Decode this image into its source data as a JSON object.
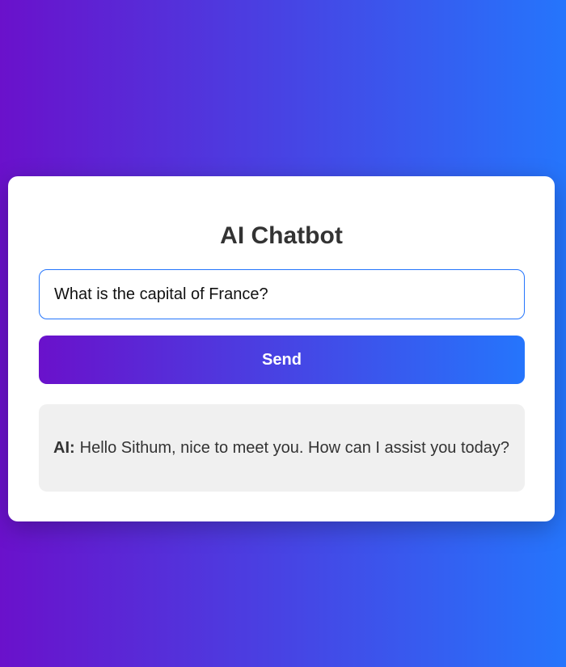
{
  "chatbot": {
    "title": "AI Chatbot",
    "input_value": "What is the capital of France?",
    "send_label": "Send",
    "response": {
      "speaker": "AI:",
      "message": "Hello Sithum, nice to meet you. How can I assist you today?"
    }
  },
  "colors": {
    "gradient_start": "#6a11cb",
    "gradient_end": "#2575fc",
    "card_background": "#ffffff",
    "response_background": "#f0f0f0",
    "text": "#333333"
  }
}
